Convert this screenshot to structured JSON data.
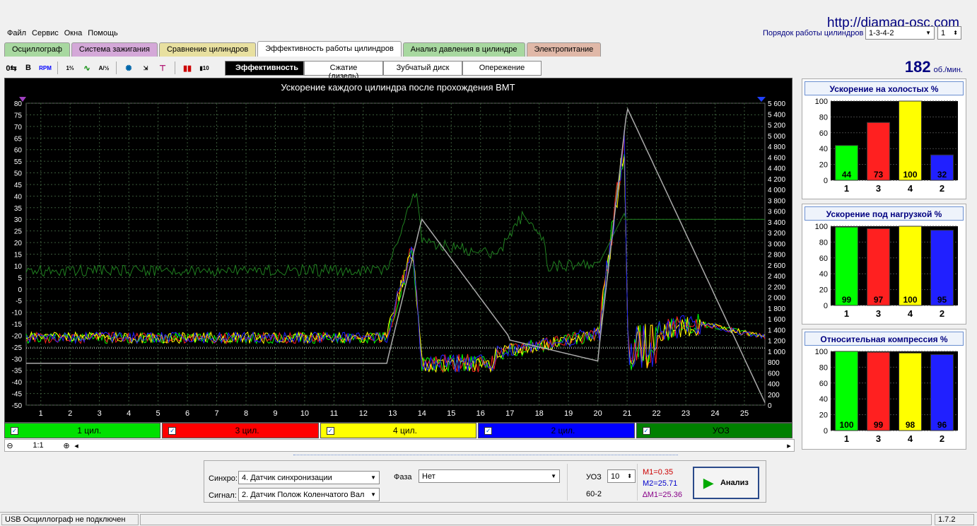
{
  "site": "http://diamag-osc.com",
  "menu": [
    "Файл",
    "Сервис",
    "Окна",
    "Помощь"
  ],
  "firing_order": {
    "label": "Порядок работы цилиндров",
    "value": "1-3-4-2",
    "num": "1"
  },
  "tabs": [
    {
      "label": "Осциллограф",
      "color": "#a8d8a0",
      "active": false
    },
    {
      "label": "Система зажигания",
      "color": "#d4a8d8",
      "active": false
    },
    {
      "label": "Сравнение цилиндров",
      "color": "#e8e0a0",
      "active": false
    },
    {
      "label": "Эффективность работы цилиндров",
      "color": "#ffffff",
      "active": true
    },
    {
      "label": "Анализ давления в цилиндре",
      "color": "#a8d8a0",
      "active": false
    },
    {
      "label": "Электропитание",
      "color": "#e0b8a8",
      "active": false
    }
  ],
  "subtabs": [
    {
      "label": "Эффективность",
      "active": true
    },
    {
      "label": "Сжатие (дизель)",
      "active": false
    },
    {
      "label": "Зубчатый диск",
      "active": false
    },
    {
      "label": "Опережение",
      "active": false
    }
  ],
  "rpm": {
    "value": "182",
    "unit": "об./мин."
  },
  "chart_data": {
    "type": "line",
    "title": "Ускорение каждого цилиндра после прохождения ВМТ",
    "x_ticks": [
      1,
      2,
      3,
      4,
      5,
      6,
      7,
      8,
      9,
      10,
      11,
      12,
      13,
      14,
      15,
      16,
      17,
      18,
      19,
      20,
      21,
      22,
      23,
      24,
      25
    ],
    "y_left_ticks": [
      80,
      75,
      70,
      65,
      60,
      55,
      50,
      45,
      40,
      35,
      30,
      25,
      20,
      15,
      10,
      5,
      0,
      -5,
      -10,
      -15,
      -20,
      -25,
      -30,
      -35,
      -40,
      -45,
      -50
    ],
    "y_right_ticks": [
      "5 600",
      "5 400",
      "5 200",
      "5 000",
      "4 800",
      "4 600",
      "4 400",
      "4 200",
      "4 000",
      "3 800",
      "3 600",
      "3 400",
      "3 200",
      "3 000",
      "2 800",
      "2 600",
      "2 400",
      "2 200",
      "2 000",
      "1 800",
      "1 600",
      "1 400",
      "1 200",
      "1 000",
      "800",
      "600",
      "400",
      "200",
      "0"
    ],
    "ylim_left": [
      -50,
      80
    ],
    "ylim_right": [
      0,
      5600
    ],
    "xlim": [
      0.5,
      25.7
    ],
    "series": [
      {
        "name": "1 цил.",
        "color": "#00ff00"
      },
      {
        "name": "3 цил.",
        "color": "#ff2020"
      },
      {
        "name": "4 цил.",
        "color": "#ffff00"
      },
      {
        "name": "2 цил.",
        "color": "#2020ff"
      },
      {
        "name": "УОЗ",
        "color": "#008000"
      }
    ]
  },
  "channels": [
    {
      "label": "1 цил.",
      "bg": "#00e000",
      "fg": "#000"
    },
    {
      "label": "3 цил.",
      "bg": "#ff0000",
      "fg": "#000"
    },
    {
      "label": "4 цил.",
      "bg": "#ffff00",
      "fg": "#000"
    },
    {
      "label": "2 цил.",
      "bg": "#0000ff",
      "fg": "#000"
    },
    {
      "label": "УОЗ",
      "bg": "#008000",
      "fg": "#000"
    }
  ],
  "zoom": "1:1",
  "panels": [
    {
      "title": "Ускорение на холостых %",
      "labels": [
        "1",
        "3",
        "4",
        "2"
      ],
      "values": [
        44,
        73,
        100,
        32
      ]
    },
    {
      "title": "Ускорение под нагрузкой %",
      "labels": [
        "1",
        "3",
        "4",
        "2"
      ],
      "values": [
        99,
        97,
        100,
        95
      ]
    },
    {
      "title": "Относительная компрессия %",
      "labels": [
        "1",
        "3",
        "4",
        "2"
      ],
      "values": [
        100,
        99,
        98,
        96
      ]
    }
  ],
  "panel_ticks": [
    "100",
    "80",
    "60",
    "40",
    "20",
    "0"
  ],
  "bar_colors": [
    "#00ff00",
    "#ff2020",
    "#ffff00",
    "#2020ff"
  ],
  "bottom": {
    "sync_label": "Синхро:",
    "sync_value": "4.  Датчик синхронизации",
    "signal_label": "Сигнал:",
    "signal_value": "2.  Датчик Полож Коленчатого Вал",
    "phase_label": "Фаза",
    "phase_value": "Нет",
    "uoz_label": "УОЗ",
    "uoz_value": "10",
    "teeth": "60-2",
    "m1": "M1=0.35",
    "m2": "M2=25.71",
    "dm": "∆M1=25.36",
    "analyze": "Анализ"
  },
  "status": {
    "left": "USB Осциллограф не подключен",
    "version": "1.7.2"
  }
}
